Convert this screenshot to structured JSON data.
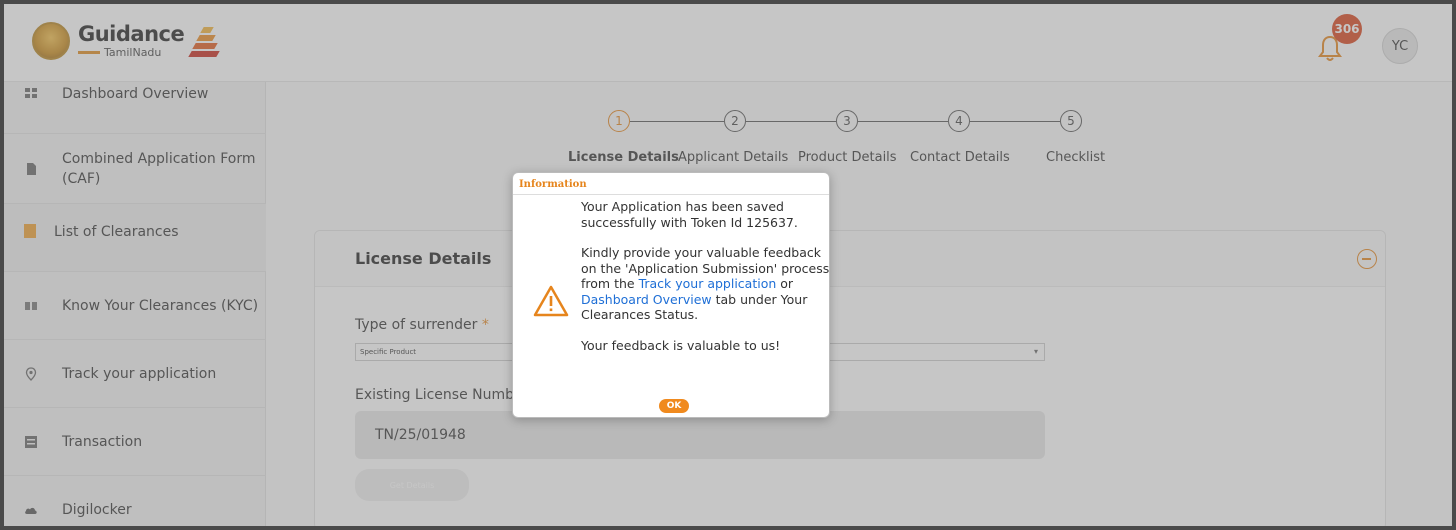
{
  "header": {
    "logo_main": "Guidance",
    "logo_sub": "TamilNadu",
    "notification_count": "306",
    "user_initials": "YC"
  },
  "sidebar": {
    "items": [
      {
        "label": "Dashboard Overview",
        "icon": "dashboard-icon"
      },
      {
        "label": "Combined Application Form (CAF)",
        "icon": "document-icon"
      },
      {
        "label": "List of Clearances",
        "icon": "list-icon"
      },
      {
        "label": "Know Your Clearances (KYC)",
        "icon": "book-icon"
      },
      {
        "label": "Track your application",
        "icon": "location-pin-icon"
      },
      {
        "label": "Transaction",
        "icon": "transaction-icon"
      },
      {
        "label": "Digilocker",
        "icon": "cloud-icon"
      }
    ]
  },
  "stepper": {
    "steps": [
      {
        "num": "1",
        "label": "License Details"
      },
      {
        "num": "2",
        "label": "Applicant Details"
      },
      {
        "num": "3",
        "label": "Product Details"
      },
      {
        "num": "4",
        "label": "Contact Details"
      },
      {
        "num": "5",
        "label": "Checklist"
      }
    ]
  },
  "card": {
    "title": "License Details",
    "surrender_label": "Type of surrender",
    "required_mark": "*",
    "surrender_value": "Specific Product",
    "license_label": "Existing License Number",
    "license_value": "TN/25/01948",
    "get_details_label": "Get Details"
  },
  "dialog": {
    "title": "Information",
    "line1": "Your Application has been saved successfully with Token Id 125637.",
    "line2_pre": "Kindly provide your valuable feedback on the 'Application Submission' process from the ",
    "link1": "Track your application",
    "line2_mid": " or ",
    "link2": "Dashboard Overview",
    "line2_post": " tab under Your Clearances Status.",
    "line3": "Your feedback is valuable to us!",
    "ok_label": "OK"
  },
  "colors": {
    "accent": "#e6851d",
    "link": "#1f6fd6",
    "badge": "#d9441c"
  }
}
